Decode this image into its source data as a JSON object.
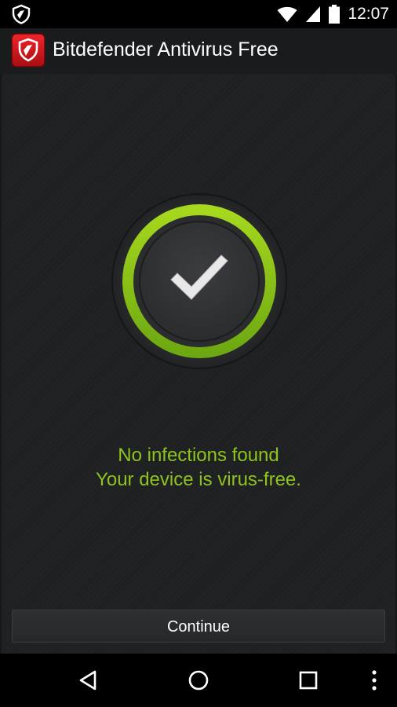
{
  "status_bar": {
    "time": "12:07",
    "icons": [
      "bitdefender-shield-icon",
      "wifi-icon",
      "cell-signal-icon",
      "battery-icon"
    ]
  },
  "app_bar": {
    "title": "Bitdefender Antivirus Free",
    "logo_icon": "bitdefender-logo-icon"
  },
  "scan_result": {
    "status_icon": "checkmark-icon",
    "line1": "No infections found",
    "line2": "Your device is virus-free."
  },
  "actions": {
    "continue_label": "Continue"
  },
  "nav_bar": {
    "icons": [
      "back-icon",
      "home-icon",
      "recents-icon",
      "overflow-menu-icon"
    ]
  },
  "colors": {
    "accent_green": "#8fc31f",
    "brand_red": "#d7141a",
    "background": "#1e2022"
  }
}
